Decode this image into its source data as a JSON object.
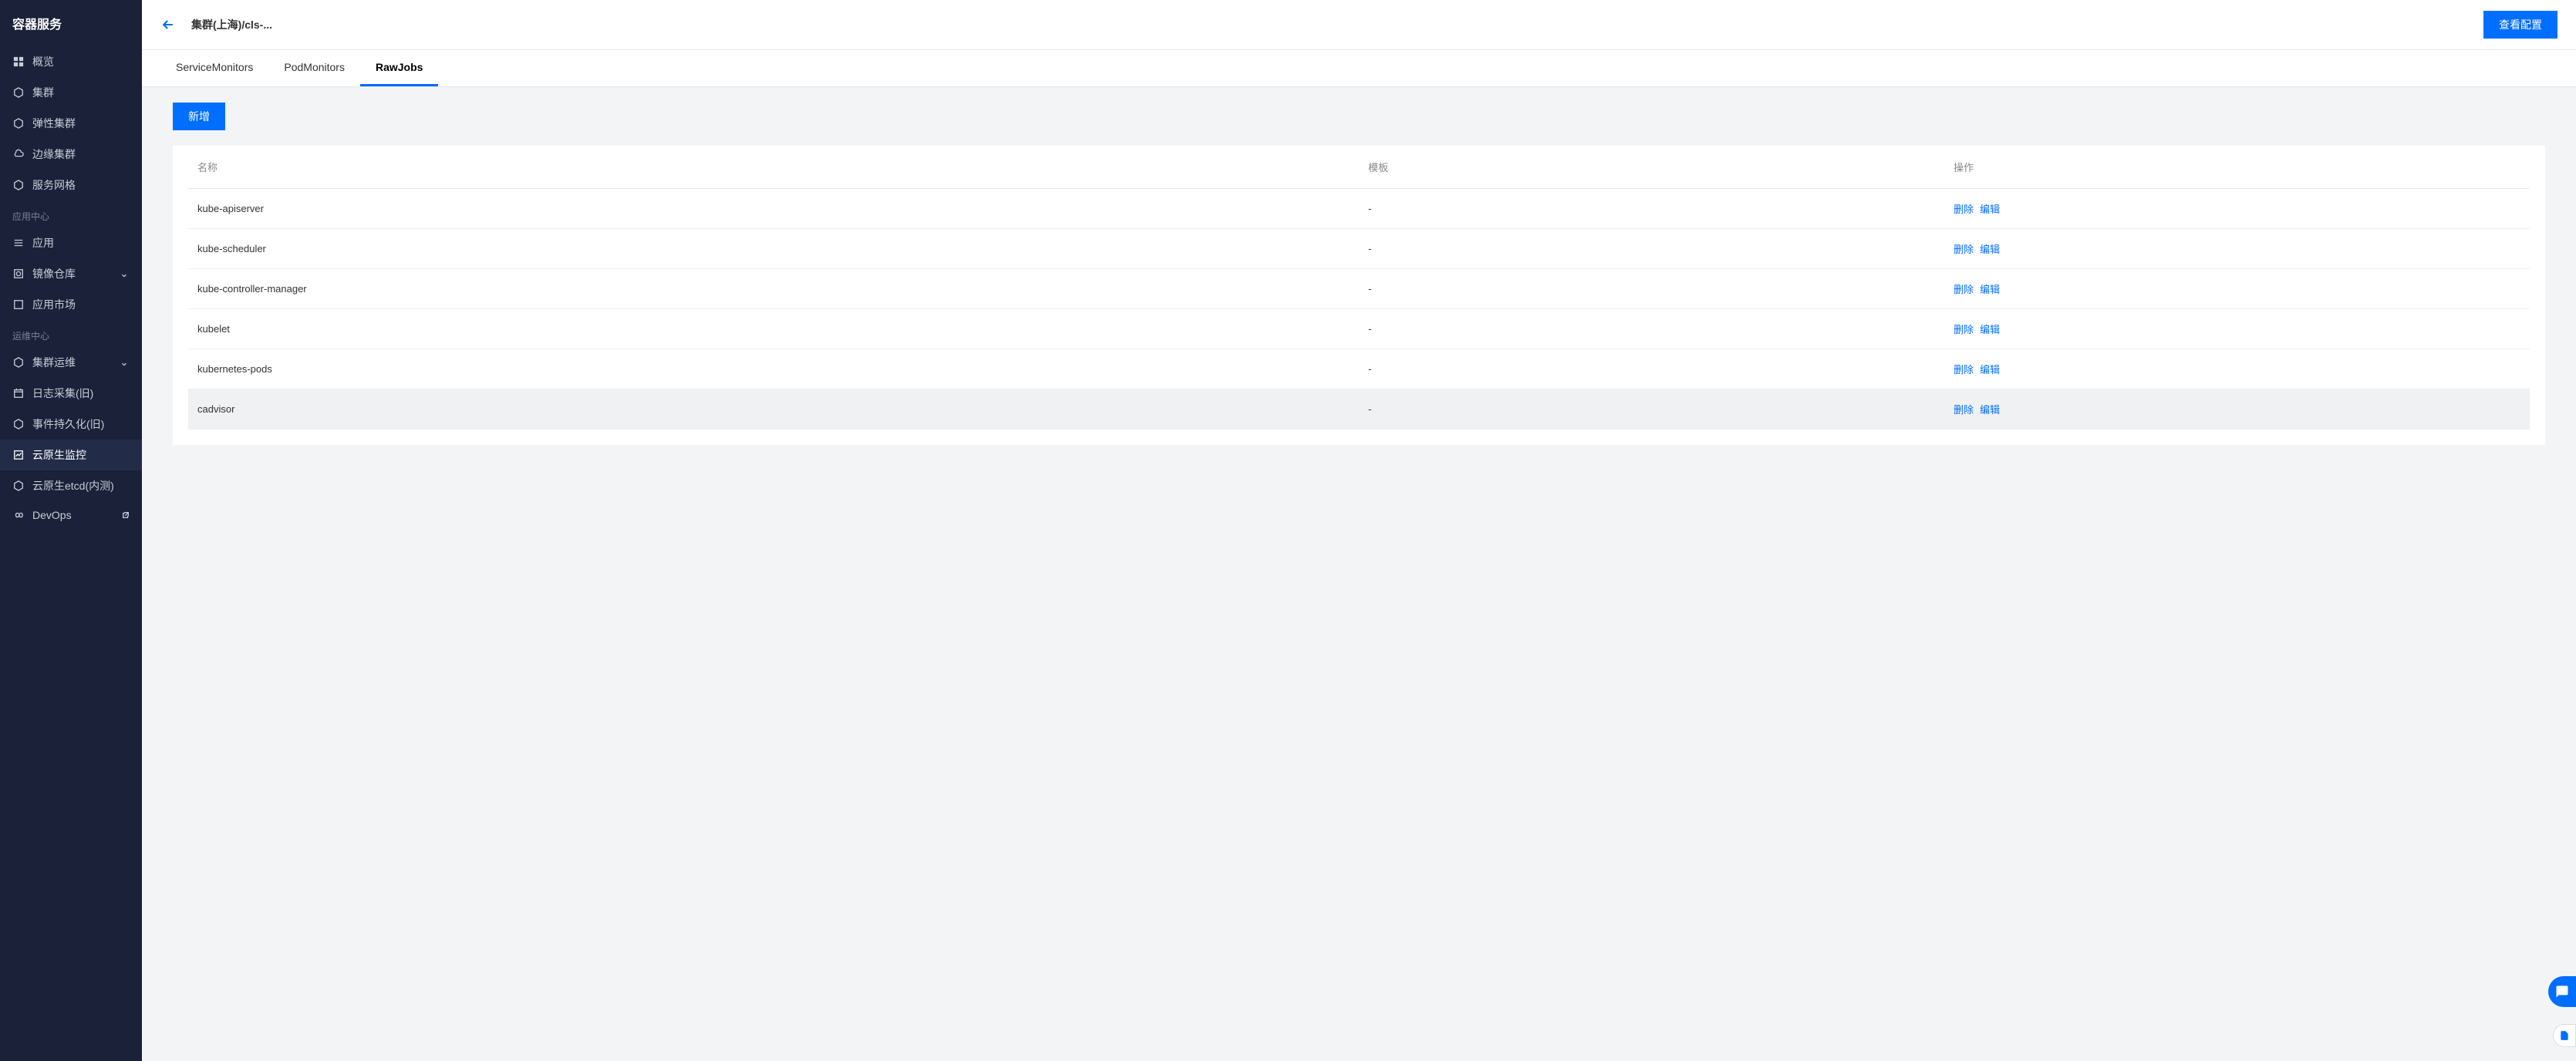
{
  "sidebar": {
    "title": "容器服务",
    "items": [
      {
        "label": "概览",
        "icon": "grid"
      },
      {
        "label": "集群",
        "icon": "hex"
      },
      {
        "label": "弹性集群",
        "icon": "hex"
      },
      {
        "label": "边缘集群",
        "icon": "cloud"
      },
      {
        "label": "服务网格",
        "icon": "hex"
      }
    ],
    "section_app": "应用中心",
    "app_items": [
      {
        "label": "应用",
        "icon": "bars"
      },
      {
        "label": "镜像仓库",
        "icon": "box",
        "expandable": true
      },
      {
        "label": "应用市场",
        "icon": "square"
      }
    ],
    "section_ops": "运维中心",
    "ops_items": [
      {
        "label": "集群运维",
        "icon": "hex",
        "expandable": true
      },
      {
        "label": "日志采集(旧)",
        "icon": "calendar"
      },
      {
        "label": "事件持久化(旧)",
        "icon": "hex"
      },
      {
        "label": "云原生监控",
        "icon": "chart",
        "active": true
      },
      {
        "label": "云原生etcd(内测)",
        "icon": "hex"
      },
      {
        "label": "DevOps",
        "icon": "infinity",
        "external": true
      }
    ]
  },
  "header": {
    "breadcrumb": "集群(上海)/cls-...",
    "view_config": "查看配置"
  },
  "tabs": [
    {
      "label": "ServiceMonitors",
      "active": false
    },
    {
      "label": "PodMonitors",
      "active": false
    },
    {
      "label": "RawJobs",
      "active": true
    }
  ],
  "content": {
    "add_label": "新增",
    "columns": {
      "name": "名称",
      "template": "模板",
      "ops": "操作"
    },
    "ops": {
      "delete": "删除",
      "edit": "编辑"
    },
    "rows": [
      {
        "name": "kube-apiserver",
        "template": "-"
      },
      {
        "name": "kube-scheduler",
        "template": "-"
      },
      {
        "name": "kube-controller-manager",
        "template": "-"
      },
      {
        "name": "kubelet",
        "template": "-"
      },
      {
        "name": "kubernetes-pods",
        "template": "-"
      },
      {
        "name": "cadvisor",
        "template": "-",
        "hovered": true
      }
    ]
  }
}
